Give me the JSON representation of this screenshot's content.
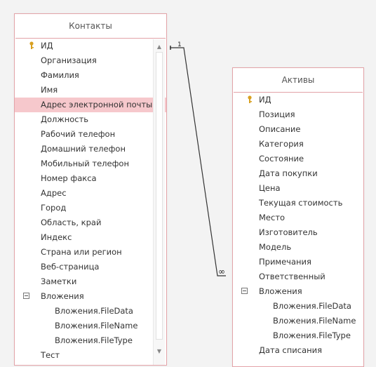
{
  "contacts": {
    "title": "Контакты",
    "fields": [
      {
        "label": "ИД",
        "key": true
      },
      {
        "label": "Организация"
      },
      {
        "label": "Фамилия"
      },
      {
        "label": "Имя"
      },
      {
        "label": "Адрес электронной почты",
        "selected": true
      },
      {
        "label": "Должность"
      },
      {
        "label": "Рабочий телефон"
      },
      {
        "label": "Домашний телефон"
      },
      {
        "label": "Мобильный телефон"
      },
      {
        "label": "Номер факса"
      },
      {
        "label": "Адрес"
      },
      {
        "label": "Город"
      },
      {
        "label": "Область, край"
      },
      {
        "label": "Индекс"
      },
      {
        "label": "Страна или регион"
      },
      {
        "label": "Веб-страница"
      },
      {
        "label": "Заметки"
      },
      {
        "label": "Вложения",
        "expander": true
      },
      {
        "label": "Вложения.FileData",
        "child": true
      },
      {
        "label": "Вложения.FileName",
        "child": true
      },
      {
        "label": "Вложения.FileType",
        "child": true
      },
      {
        "label": "Тест"
      }
    ]
  },
  "assets": {
    "title": "Активы",
    "fields": [
      {
        "label": "ИД",
        "key": true
      },
      {
        "label": "Позиция"
      },
      {
        "label": "Описание"
      },
      {
        "label": "Категория"
      },
      {
        "label": "Состояние"
      },
      {
        "label": "Дата покупки"
      },
      {
        "label": "Цена"
      },
      {
        "label": "Текущая стоимость"
      },
      {
        "label": "Место"
      },
      {
        "label": "Изготовитель"
      },
      {
        "label": "Модель"
      },
      {
        "label": "Примечания"
      },
      {
        "label": "Ответственный"
      },
      {
        "label": "Вложения",
        "expander": true
      },
      {
        "label": "Вложения.FileData",
        "child": true
      },
      {
        "label": "Вложения.FileName",
        "child": true
      },
      {
        "label": "Вложения.FileType",
        "child": true
      },
      {
        "label": "Дата списания"
      }
    ]
  },
  "relationship": {
    "one_side_symbol": "1",
    "many_side_symbol": "∞"
  },
  "colors": {
    "border": "#e3a3a8",
    "selected": "#f6c8cc",
    "key": "#d8a020"
  }
}
